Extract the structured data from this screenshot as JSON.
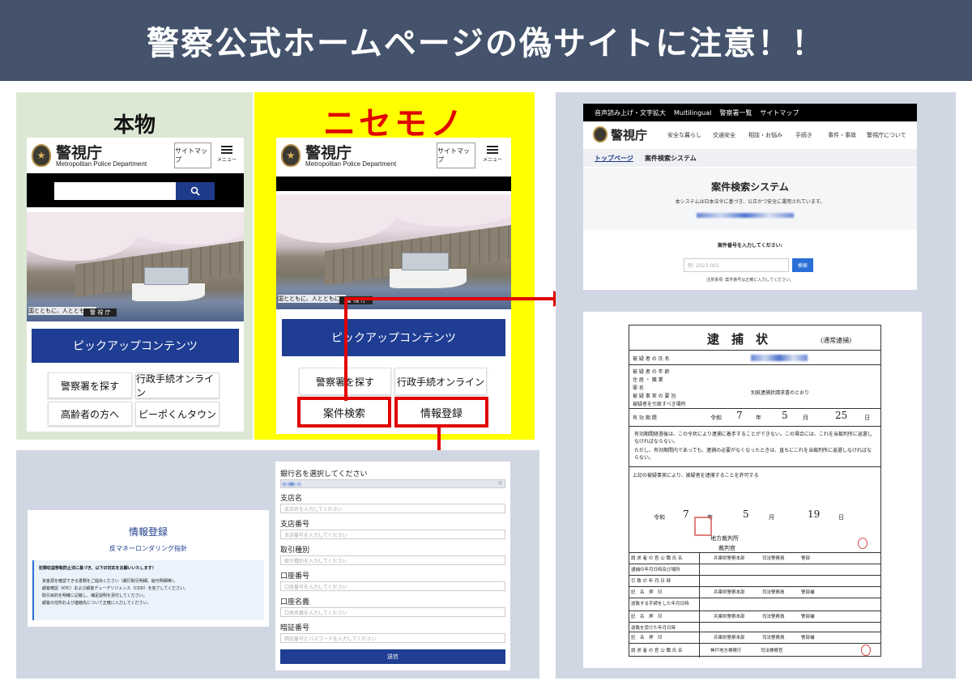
{
  "banner": {
    "title": "警察公式ホームページの偽サイトに注意！！"
  },
  "real": {
    "label": "本物",
    "header": {
      "name": "警視庁",
      "sub": "Metropolitan Police Department",
      "sitemap": "サイトマップ",
      "menu": "メニュー"
    },
    "photo_caption": "国とともに、人とともに。",
    "photo_caption2": "警 視 庁",
    "pickup": "ピックアップコンテンツ",
    "buttons": [
      "警察署を探す",
      "行政手続オンライン",
      "高齢者の方へ",
      "ピーポくんタウン"
    ]
  },
  "fake": {
    "label": "ニセモノ",
    "header": {
      "name": "警視庁",
      "sub": "Metropolitan Police Department",
      "sitemap": "サイトマップ",
      "menu": "メニュー"
    },
    "photo_caption": "国とともに、人とともに。",
    "photo_caption2": "警 視 庁",
    "pickup": "ピックアップコンテンツ",
    "buttons": [
      "警察署を探す",
      "行政手続オンライン",
      "案件検索",
      "情報登録"
    ]
  },
  "case_search": {
    "topnav": [
      "音声読み上げ・文字拡大",
      "Multilingual",
      "警察署一覧",
      "サイトマップ"
    ],
    "site_name": "警視庁",
    "nav": [
      "安全な暮らし",
      "交通安全",
      "相談・お悩み",
      "手続き",
      "事件・事故",
      "警視庁について"
    ],
    "breadcrumb_home": "トップページ",
    "breadcrumb_current": "案件検索システム",
    "title": "案件検索システム",
    "desc": "本システムは日本法令に基づき、公正かつ安全に運用されています。",
    "prompt": "案件番号を入力してください:",
    "placeholder": "例: 2023-001",
    "search_btn": "検索",
    "note": "注意事項: 案件番号は正確に入力してください。"
  },
  "warrant": {
    "title": "逮　捕　状",
    "title_note": "(通常逮捕)",
    "rows": [
      "被 疑 者 の 氏 名",
      "被 疑 者 の 年 齢",
      "住 居 ・ 職 業",
      "罪 名",
      "被 疑 事 実 の 要 旨",
      "被疑者を引致すべき場所"
    ],
    "crime": "別紙逮捕状請求書のとおり",
    "valid_label": "有 効 期 間",
    "valid_era": "令和",
    "valid_y": "7",
    "valid_nen": "年",
    "valid_m": "5",
    "valid_tsuki": "月",
    "valid_d": "25",
    "valid_hi": "日",
    "notice1": "有効期間経過後は、この令状により逮捕に着手することができない。この場合には、これを当裁判所に返還しなければならない。",
    "notice2": "ただし、有効期間内であっても、逮捕の必要がなくなったときは、直ちにこれを当裁判所に返還しなければならない。",
    "authorize": "上記の被疑事実により、被疑者を逮捕することを許可する",
    "issue_era": "令和",
    "issue_y": "7",
    "issue_nen": "年",
    "issue_m": "5",
    "issue_tsuki": "月",
    "issue_d": "19",
    "issue_hi": "日",
    "court": "地方裁判所",
    "judge_label": "裁判官",
    "lower_rows": [
      "請 求 者 の 官 公 職 氏 名",
      "逮捕の年月日時及び場所",
      "引 致 の 年 月 日 時",
      "記　名　押　印",
      "送致する手続をした年月日時",
      "記　名　押　印",
      "送致を受けた年月日時",
      "記　名　押　印",
      "請 求 者 の 官 公 職 氏 名"
    ],
    "police": "兵庫県警察本部",
    "police2": "司法警察員",
    "rank": "警部補",
    "rank2": "警部",
    "prosecutor": "神戸地方検察庁",
    "prosecutor2": "司法検察官"
  },
  "info_reg": {
    "title": "情報登録",
    "subtitle": "反マネーロンダリング指針",
    "notice_head": "犯罪収益移転防止法に基づき、以下の対応をお願いいたします！",
    "bullets": [
      "資金源を確認できる書類をご提出ください（銀行取引明細、給与明細等）。",
      "顧客確認（KYC）および顧客デューデリジェンス（CDD）を完了してください。",
      "取引目的を明確に記載し、補足説明を添付してください。",
      "顧客の住所および連絡先について正確に入力してください。"
    ]
  },
  "bank_form": {
    "bank_label": "銀行名を選択してください",
    "fields": [
      {
        "label": "支店名",
        "placeholder": "支店名を入力してください"
      },
      {
        "label": "支店番号",
        "placeholder": "支店番号を入力してください"
      },
      {
        "label": "取引種別",
        "placeholder": "取引種別を入力してください"
      },
      {
        "label": "口座番号",
        "placeholder": "口座番号を入力してください"
      },
      {
        "label": "口座名義",
        "placeholder": "口座名義を入力してください"
      },
      {
        "label": "暗証番号",
        "placeholder": "暗証番号とパスワードを入力してください"
      }
    ],
    "submit": "送信"
  },
  "colors": {
    "banner": "#44536b",
    "fake_bg": "#ffff00",
    "real_bg": "#dde8d4",
    "alert_red": "#e00000",
    "pickup_blue": "#1e3d93"
  }
}
